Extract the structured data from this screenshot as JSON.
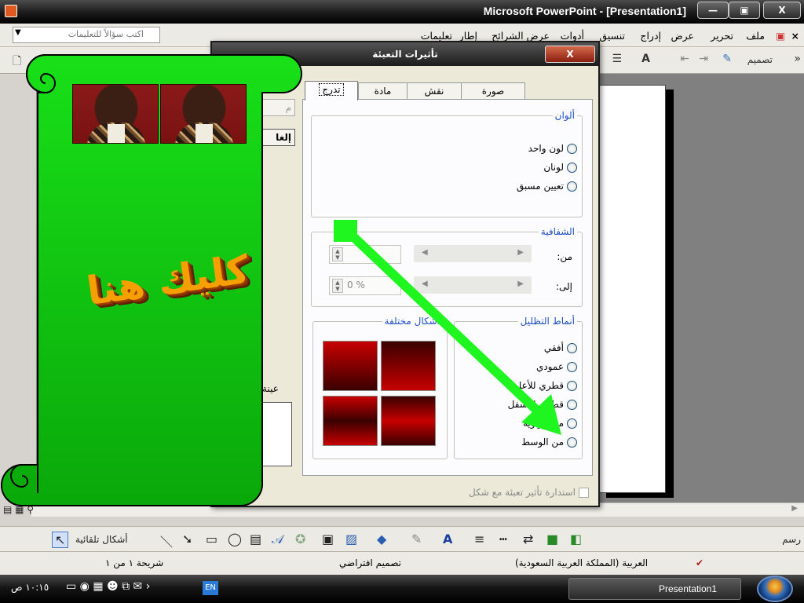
{
  "window": {
    "title": "Microsoft PowerPoint - [Presentation1]",
    "min_label": "—",
    "max_label": "▣",
    "close_label": "X"
  },
  "menu": {
    "items": [
      "ملف",
      "تحرير",
      "عرض",
      "إدراج",
      "تنسيق",
      "أدوات",
      "عرض الشرائح",
      "إطار",
      "تعليمات"
    ],
    "close_doc": "×",
    "ask_placeholder": "اكتب سؤالاً للتعليمات"
  },
  "toolbar": {
    "design_label": "تصميم",
    "font_grow": "A"
  },
  "dialog": {
    "title": "تأثيرات التعبئة",
    "close_label": "X",
    "tabs": [
      "تدرج",
      "مادة",
      "نقش",
      "صورة"
    ],
    "colors_group": {
      "label": "ألوان",
      "options": [
        "لون واحد",
        "لونان",
        "تعيين مسبق"
      ]
    },
    "transparency_group": {
      "label": "الشفافية",
      "from_label": "من:",
      "to_label": "إلى:",
      "to_value": "0 %"
    },
    "shading_group": {
      "label": "أنماط التظليل",
      "options": [
        "أفقي",
        "عمودي",
        "قطري للأعلى",
        "قطري للأسفل",
        "من الزاوية",
        "من الوسط"
      ]
    },
    "variants_group": {
      "label": "أشكال مختلفة"
    },
    "sample_label": "عينة:",
    "ok_partial": "م",
    "cancel_partial": "إلغا",
    "rotate_label": "استدارة تأثير تعبئة مع شكل"
  },
  "scroll": {
    "wordart": "كليك هنا"
  },
  "drawbar": {
    "draw_label": "رسم",
    "autoshapes_label": "أشكال تلقائية"
  },
  "status": {
    "slide": "شريحة ١ من ١",
    "design": "تصميم افتراضي",
    "language": "العربية (المملكة العربية السعودية)"
  },
  "taskbar": {
    "task_label": "Presentation1",
    "lang": "EN",
    "clock": "١٠:١٥ ص"
  },
  "colors": {
    "scroll_green": "#14d814",
    "scroll_dark": "#0a9a0a",
    "arrow_green": "#1ff51f",
    "swatch_red": "#c80000"
  }
}
